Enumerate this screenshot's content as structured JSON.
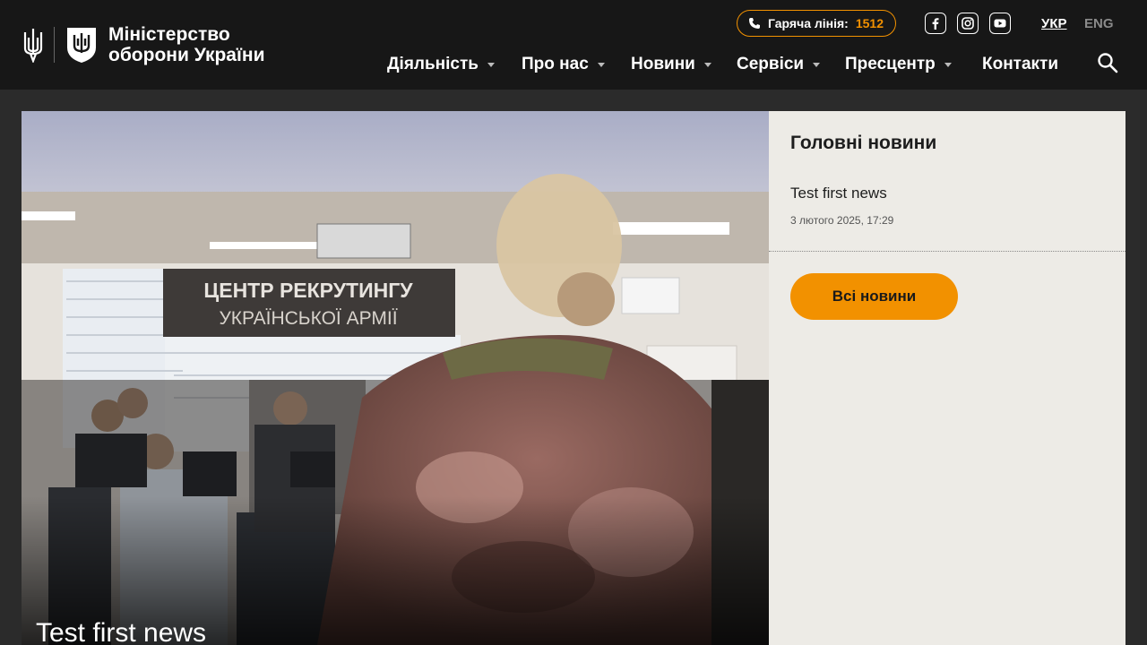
{
  "header": {
    "logo_line1": "Міністерство",
    "logo_line2": "оборони України",
    "hotline_label": "Гаряча лінія:",
    "hotline_number": "1512",
    "social": [
      "facebook-icon",
      "instagram-icon",
      "youtube-icon"
    ],
    "lang_active": "УКР",
    "lang_other": "ENG"
  },
  "nav": {
    "items": [
      {
        "label": "Діяльність",
        "has_dropdown": true
      },
      {
        "label": "Про нас",
        "has_dropdown": true
      },
      {
        "label": "Новини",
        "has_dropdown": true
      },
      {
        "label": "Сервіси",
        "has_dropdown": true
      },
      {
        "label": "Пресцентр",
        "has_dropdown": true
      },
      {
        "label": "Контакти",
        "has_dropdown": false
      }
    ]
  },
  "hero": {
    "title": "Test first news",
    "sign_line1": "ЦЕНТР РЕКРУТИНГУ",
    "sign_line2": "УКРАЇНСЬКОЇ АРМІЇ"
  },
  "sidebar": {
    "heading": "Головні новини",
    "news": [
      {
        "title": "Test first news",
        "date": "3 лютого 2025, 17:29"
      }
    ],
    "all_news_label": "Всі новини"
  },
  "colors": {
    "accent": "#f29100",
    "header_bg": "#171717",
    "page_bg": "#2b2b2b",
    "sidebar_bg": "#edebe6"
  }
}
